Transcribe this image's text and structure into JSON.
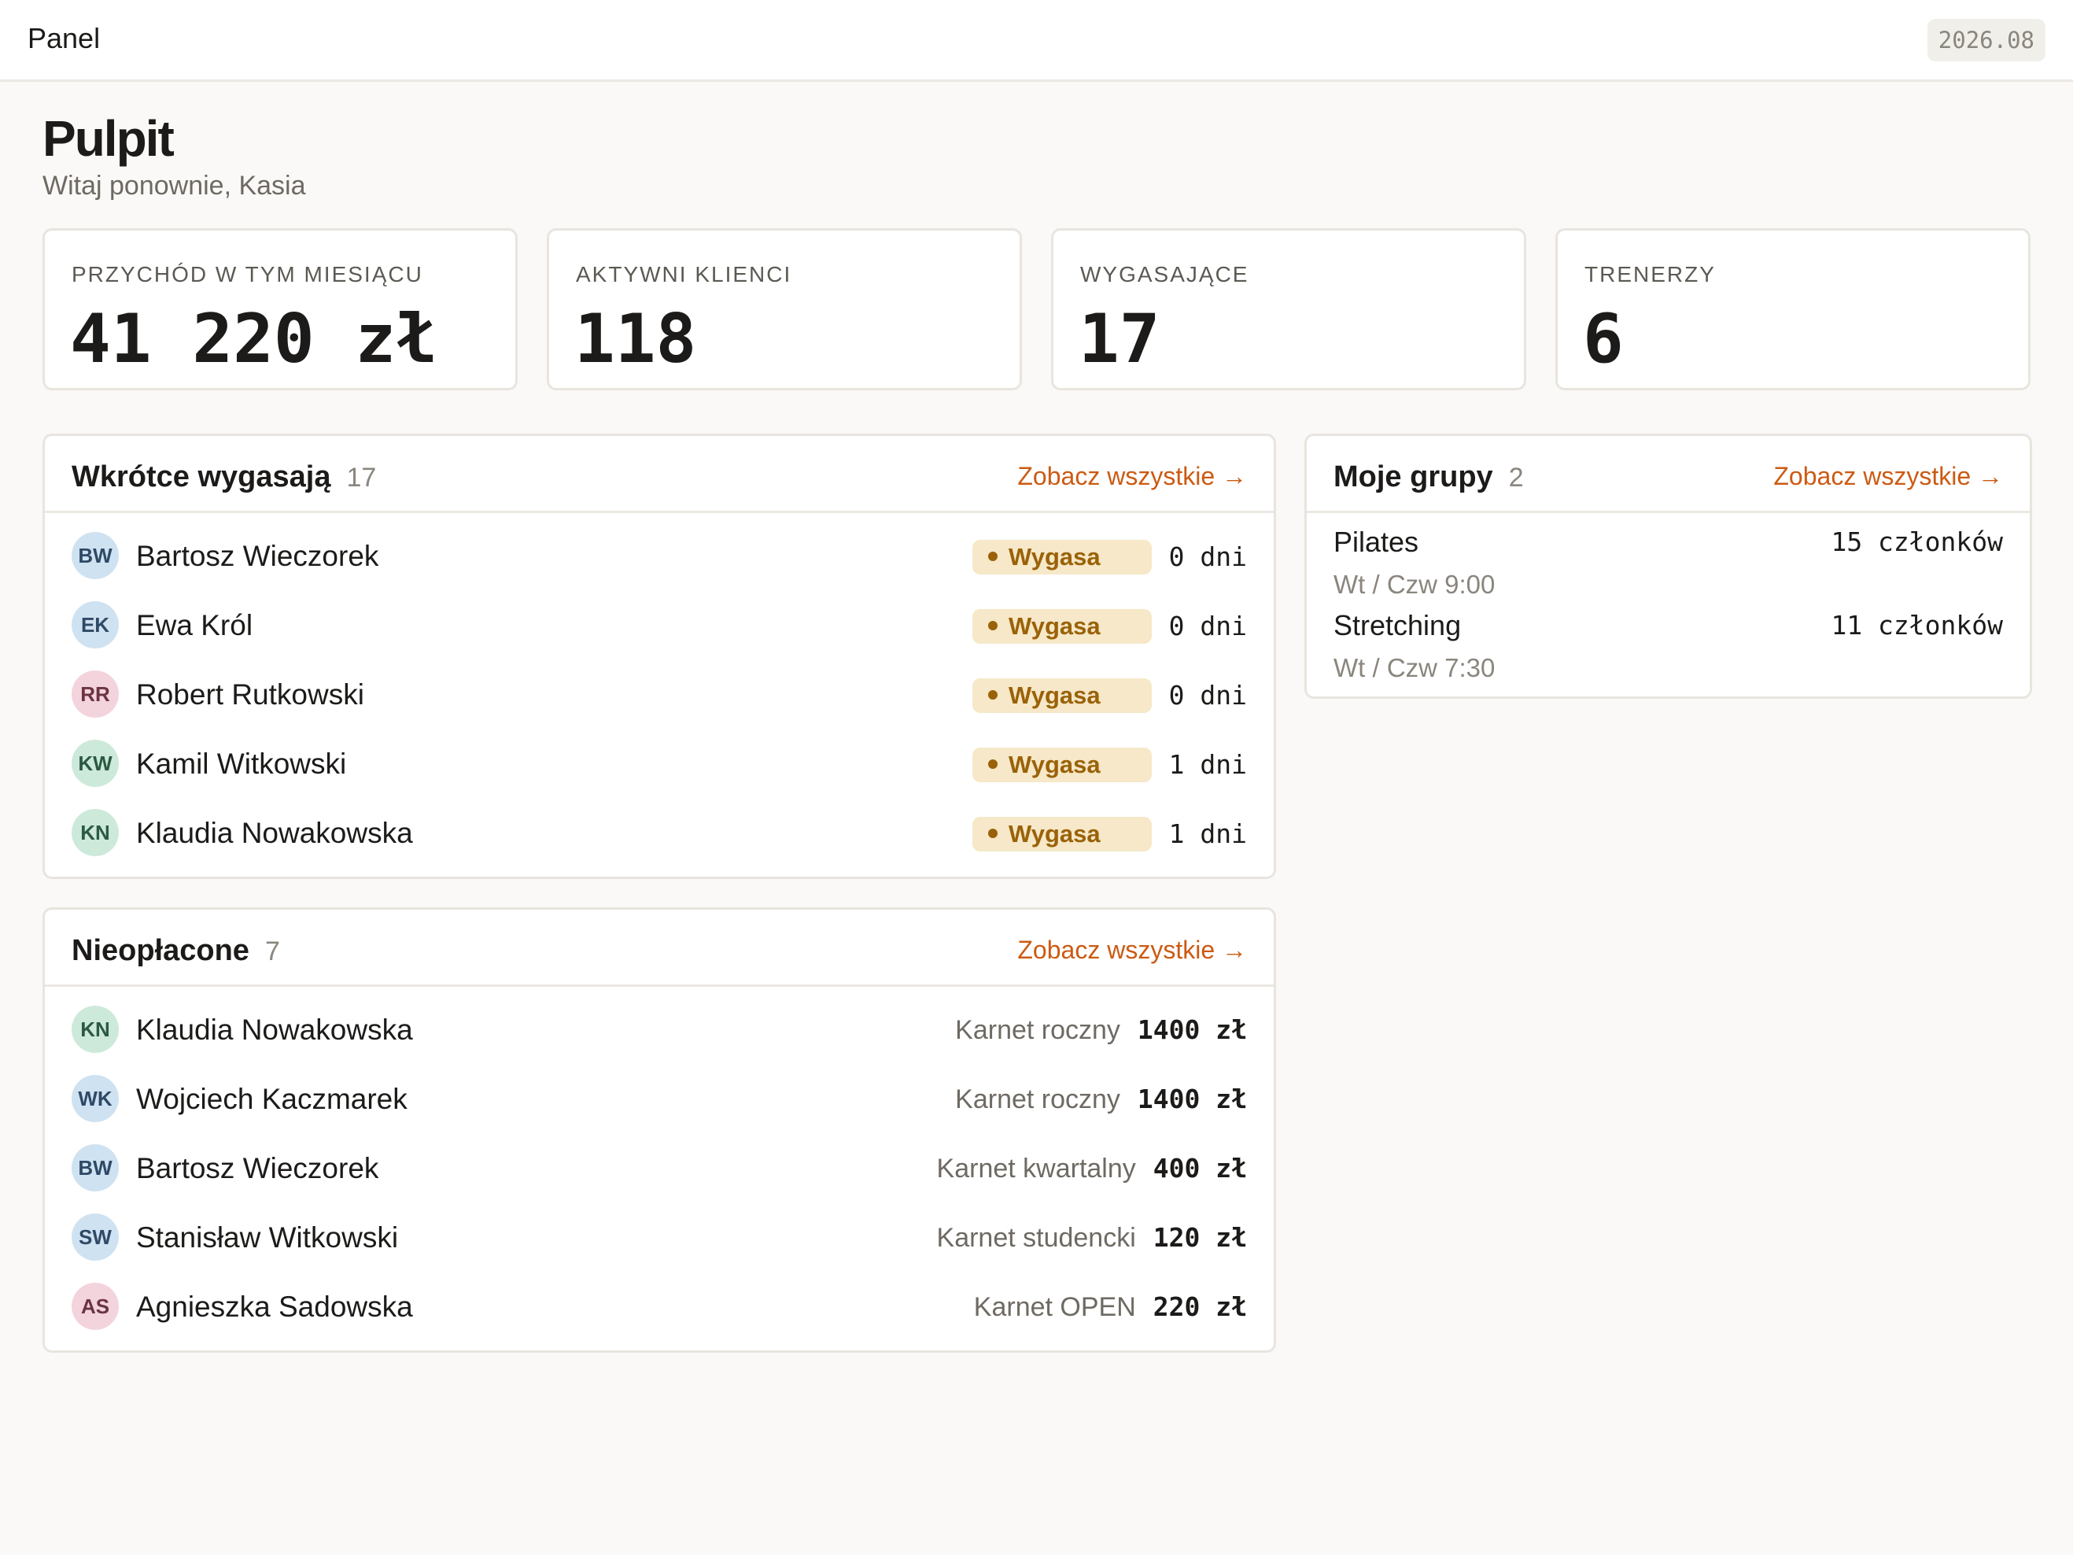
{
  "topbar": {
    "title": "Panel",
    "period": "2026.08"
  },
  "header": {
    "title": "Pulpit",
    "subtitle": "Witaj ponownie, Kasia"
  },
  "stats": [
    {
      "label": "PRZYCHÓD W TYM MIESIĄCU",
      "value": "41 220 zł"
    },
    {
      "label": "AKTYWNI KLIENCI",
      "value": "118"
    },
    {
      "label": "WYGASAJĄCE",
      "value": "17"
    },
    {
      "label": "TRENERZY",
      "value": "6"
    }
  ],
  "expiring": {
    "title": "Wkrótce wygasają",
    "count": "17",
    "link": "Zobacz wszystkie →",
    "rows": [
      {
        "initials": "BW",
        "name": "Bartosz Wieczorek",
        "status": "Wygasa",
        "days": "0 dni",
        "avatar_color": "blue"
      },
      {
        "initials": "EK",
        "name": "Ewa Król",
        "status": "Wygasa",
        "days": "0 dni",
        "avatar_color": "blue"
      },
      {
        "initials": "RR",
        "name": "Robert Rutkowski",
        "status": "Wygasa",
        "days": "0 dni",
        "avatar_color": "pink"
      },
      {
        "initials": "KW",
        "name": "Kamil Witkowski",
        "status": "Wygasa",
        "days": "1 dni",
        "avatar_color": "green"
      },
      {
        "initials": "KN",
        "name": "Klaudia Nowakowska",
        "status": "Wygasa",
        "days": "1 dni",
        "avatar_color": "green"
      }
    ]
  },
  "unpaid": {
    "title": "Nieopłacone",
    "count": "7",
    "link": "Zobacz wszystkie →",
    "rows": [
      {
        "initials": "KN",
        "name": "Klaudia Nowakowska",
        "plan": "Karnet roczny",
        "amount": "1400 zł",
        "avatar_color": "green"
      },
      {
        "initials": "WK",
        "name": "Wojciech Kaczmarek",
        "plan": "Karnet roczny",
        "amount": "1400 zł",
        "avatar_color": "blue"
      },
      {
        "initials": "BW",
        "name": "Bartosz Wieczorek",
        "plan": "Karnet kwartalny",
        "amount": "400 zł",
        "avatar_color": "blue"
      },
      {
        "initials": "SW",
        "name": "Stanisław Witkowski",
        "plan": "Karnet studencki",
        "amount": "120 zł",
        "avatar_color": "blue"
      },
      {
        "initials": "AS",
        "name": "Agnieszka Sadowska",
        "plan": "Karnet OPEN",
        "amount": "220 zł",
        "avatar_color": "pink"
      }
    ]
  },
  "groups": {
    "title": "Moje grupy",
    "count": "2",
    "link": "Zobacz wszystkie →",
    "rows": [
      {
        "name": "Pilates",
        "schedule": "Wt / Czw 9:00",
        "members": "15 członków"
      },
      {
        "name": "Stretching",
        "schedule": "Wt / Czw 7:30",
        "members": "11 członków"
      }
    ]
  },
  "colors": {
    "accent": "#cc5a12",
    "badge_bg": "#f6e8c8",
    "badge_text": "#9a6208",
    "background": "#faf9f7"
  }
}
